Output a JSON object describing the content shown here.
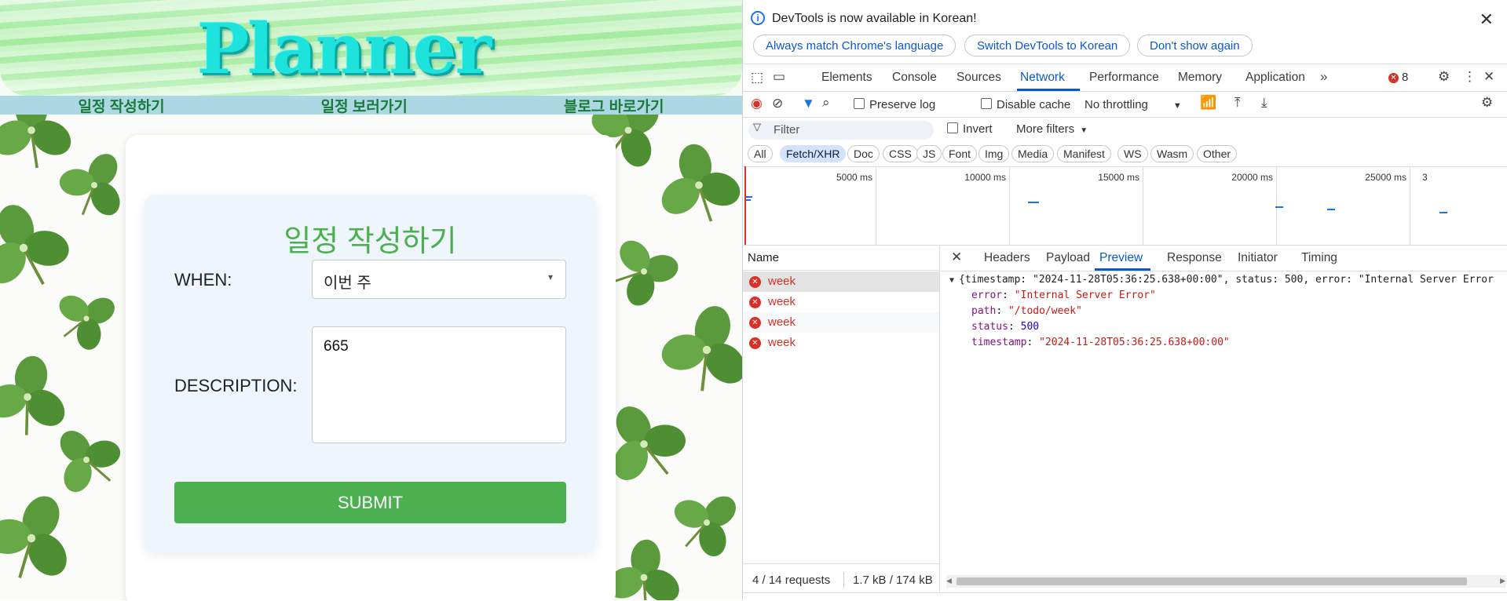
{
  "app": {
    "banner_title": "Planner",
    "nav": [
      "일정 작성하기",
      "일정 보러가기",
      "블로그 바로가기"
    ],
    "form": {
      "title": "일정 작성하기",
      "when_label": "WHEN:",
      "when_value": "이번 주",
      "description_label": "DESCRIPTION:",
      "description_value": "665",
      "submit_label": "SUBMIT"
    }
  },
  "devtools": {
    "infobar": {
      "message": "DevTools is now available in Korean!",
      "buttons": [
        "Always match Chrome's language",
        "Switch DevTools to Korean",
        "Don't show again"
      ]
    },
    "tabs": [
      "Elements",
      "Console",
      "Sources",
      "Network",
      "Performance",
      "Memory",
      "Application"
    ],
    "active_tab": "Network",
    "error_count": "8",
    "toolbar": {
      "preserve_log": "Preserve log",
      "disable_cache": "Disable cache",
      "throttling": "No throttling"
    },
    "filter": {
      "placeholder": "Filter",
      "invert": "Invert",
      "more_filters": "More filters"
    },
    "type_filters": [
      "All",
      "Fetch/XHR",
      "Doc",
      "CSS",
      "JS",
      "Font",
      "Img",
      "Media",
      "Manifest",
      "WS",
      "Wasm",
      "Other"
    ],
    "active_type": "Fetch/XHR",
    "timeline_labels": [
      "5000 ms",
      "10000 ms",
      "15000 ms",
      "20000 ms",
      "25000 ms",
      "3"
    ],
    "name_header": "Name",
    "requests": [
      "week",
      "week",
      "week",
      "week"
    ],
    "status": {
      "requests": "4 / 14 requests",
      "size": "1.7 kB / 174 kB"
    },
    "detail_tabs": [
      "Headers",
      "Payload",
      "Preview",
      "Response",
      "Initiator",
      "Timing"
    ],
    "active_detail_tab": "Preview",
    "preview": {
      "summary": "{timestamp: \"2024-11-28T05:36:25.638+00:00\", status: 500, error: \"Internal Server Error",
      "fields": [
        {
          "key": "error",
          "value": "\"Internal Server Error\"",
          "kind": "str"
        },
        {
          "key": "path",
          "value": "\"/todo/week\"",
          "kind": "str"
        },
        {
          "key": "status",
          "value": "500",
          "kind": "num"
        },
        {
          "key": "timestamp",
          "value": "\"2024-11-28T05:36:25.638+00:00\"",
          "kind": "str"
        }
      ]
    },
    "colors": {
      "accent": "#0b57d0",
      "error": "#d93025",
      "submit": "#4caf50"
    }
  }
}
